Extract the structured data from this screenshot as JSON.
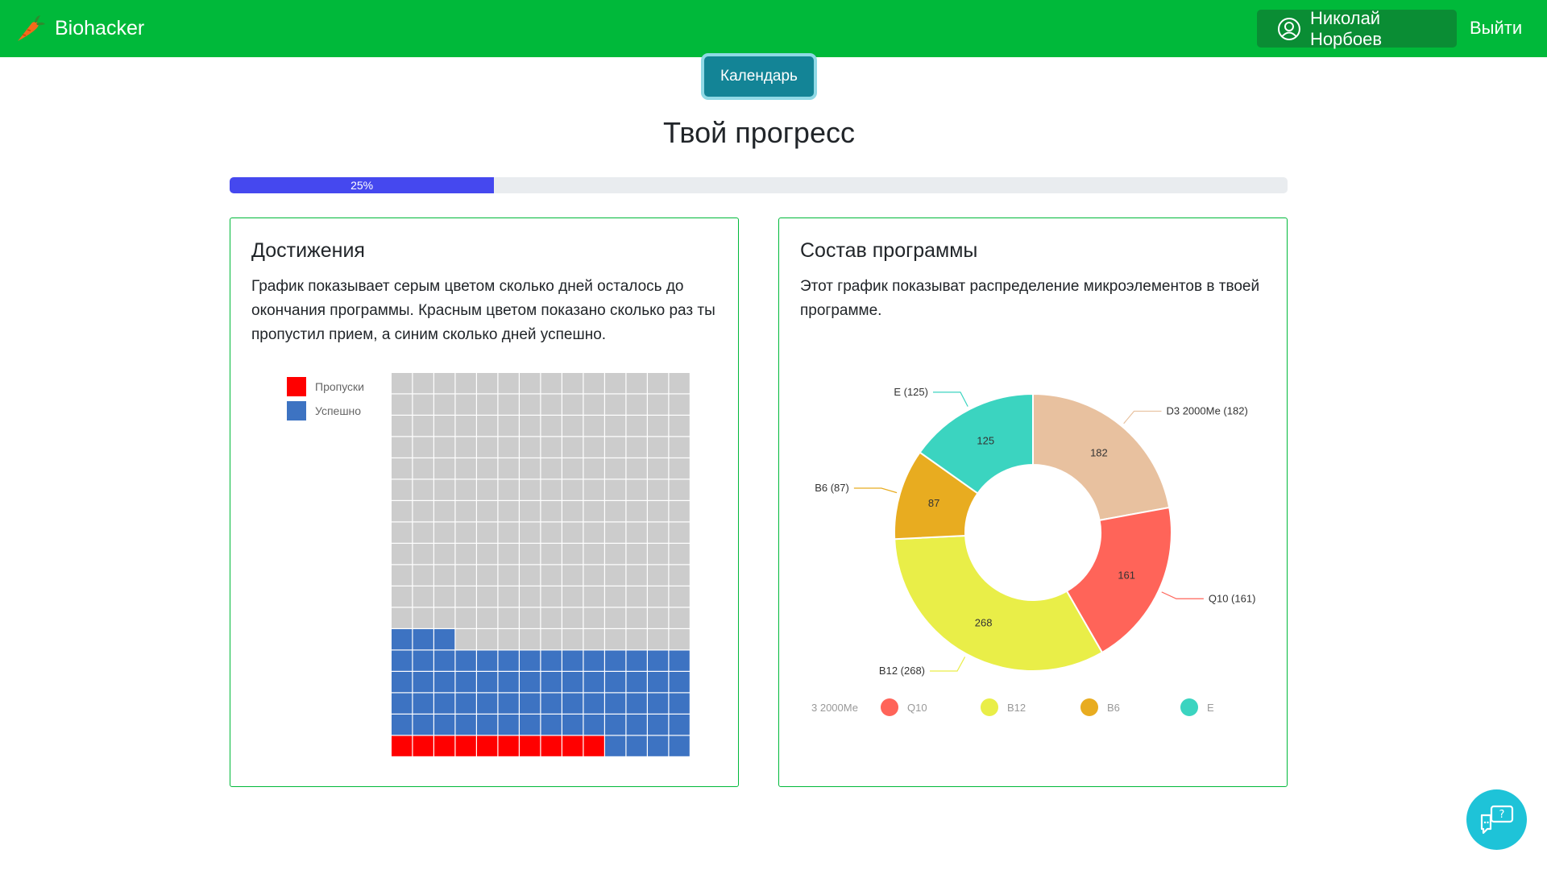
{
  "app": {
    "brand": "Biohacker",
    "user_name": "Николай Норбоев",
    "logout_label": "Выйти",
    "calendar_label": "Календарь",
    "colors": {
      "navbar": "#00b93a",
      "accent": "#138496",
      "progress": "#4548ef"
    }
  },
  "progress": {
    "title": "Твой прогресс",
    "value": 25,
    "label": "25%"
  },
  "achievements": {
    "title": "Достижения",
    "description": "График показывает серым цветом сколько дней осталось до окончания программы. Красным цветом показано сколько раз ты пропустил прием, а синим сколько дней успешно.",
    "legend": [
      {
        "label": "Пропуски",
        "color": "#ff0000"
      },
      {
        "label": "Успешно",
        "color": "#3d73c2"
      }
    ]
  },
  "composition": {
    "title": "Состав программы",
    "description": "Этот график показыват распределение микроэлементов в твоей программе.",
    "legend_first_visible_text": "3 2000Ме"
  },
  "chart_data": [
    {
      "type": "waffle",
      "columns": 14,
      "rows": 18,
      "series": [
        {
          "name": "Пропуски",
          "value": 10,
          "color": "#ff0000"
        },
        {
          "name": "Успешно",
          "value": 63,
          "color": "#3d73c2"
        },
        {
          "name": "",
          "value": 179,
          "color": "#cccccc"
        }
      ]
    },
    {
      "type": "pie",
      "donut": true,
      "slices": [
        {
          "name": "D3 2000Ме",
          "value": 182,
          "color": "#e8c19f",
          "outer_label": "D3 2000Ме (182)",
          "legend_label": "3 2000Ме"
        },
        {
          "name": "Q10",
          "value": 161,
          "color": "#ff6459",
          "outer_label": "Q10 (161)",
          "legend_label": "Q10"
        },
        {
          "name": "B12",
          "value": 268,
          "color": "#e9ee48",
          "outer_label": "B12 (268)",
          "legend_label": "B12"
        },
        {
          "name": "B6",
          "value": 87,
          "color": "#e8ac20",
          "outer_label": "B6 (87)",
          "legend_label": "B6"
        },
        {
          "name": "E",
          "value": 125,
          "color": "#3bd4c0",
          "outer_label": "E (125)",
          "legend_label": "E"
        }
      ]
    }
  ]
}
